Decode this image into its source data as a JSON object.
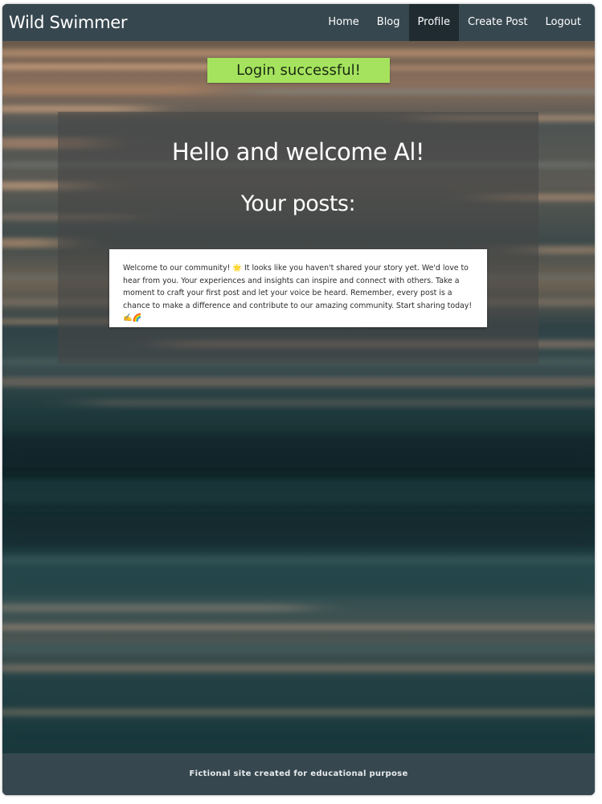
{
  "brand": "Wild Swimmer",
  "nav": {
    "items": [
      {
        "label": "Home",
        "active": false
      },
      {
        "label": "Blog",
        "active": false
      },
      {
        "label": "Profile",
        "active": true
      },
      {
        "label": "Create Post",
        "active": false
      },
      {
        "label": "Logout",
        "active": false
      }
    ]
  },
  "alert": {
    "message": "Login successful!",
    "color": "#a5e35e"
  },
  "main": {
    "welcome_heading": "Hello and welcome Al!",
    "posts_heading": "Your posts:",
    "empty_post_message": "Welcome to our community! 🌟 It looks like you haven't shared your story yet. We'd love to hear from you. Your experiences and insights can inspire and connect with others. Take a moment to craft your first post and let your voice be heard. Remember, every post is a chance to make a difference and contribute to our amazing community. Start sharing today! ✍️🌈"
  },
  "footer": {
    "text": "Fictional site created for educational purpose"
  },
  "colors": {
    "navbar": "#37474f",
    "active_nav": "#1f2b30",
    "footer": "#37474f"
  },
  "background_image": "ocean-water-long-exposure"
}
